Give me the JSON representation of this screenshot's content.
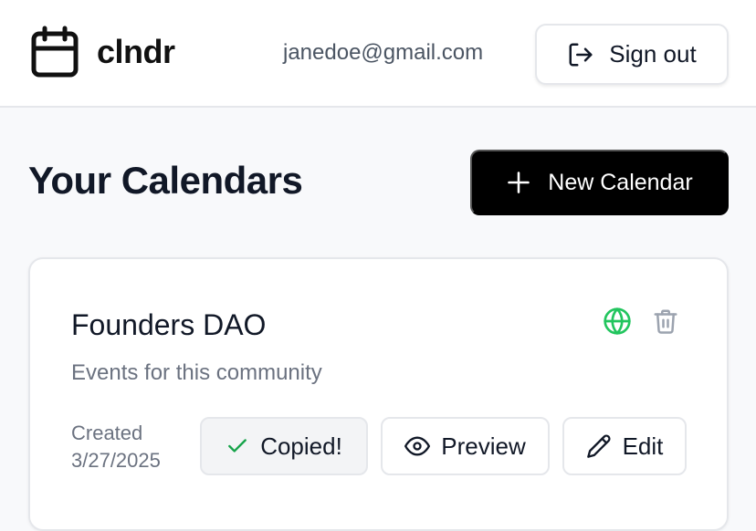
{
  "header": {
    "app_name": "clndr",
    "user_email": "janedoe@gmail.com",
    "sign_out_label": "Sign out",
    "brand_icon": "calendar-icon",
    "sign_out_icon": "log-out-icon"
  },
  "main": {
    "title": "Your Calendars",
    "new_calendar_label": "New Calendar",
    "new_calendar_icon": "plus-icon"
  },
  "calendars": [
    {
      "name": "Founders DAO",
      "description": "Events for this community",
      "created_label": "Created",
      "created_date": "3/27/2025",
      "visibility_icon": "globe-icon",
      "visibility_color": "#22c55e",
      "delete_icon": "trash-icon",
      "copy_label": "Copied!",
      "copy_icon": "check-icon",
      "copy_icon_color": "#16a34a",
      "preview_label": "Preview",
      "preview_icon": "eye-icon",
      "edit_label": "Edit",
      "edit_icon": "pencil-icon"
    }
  ]
}
